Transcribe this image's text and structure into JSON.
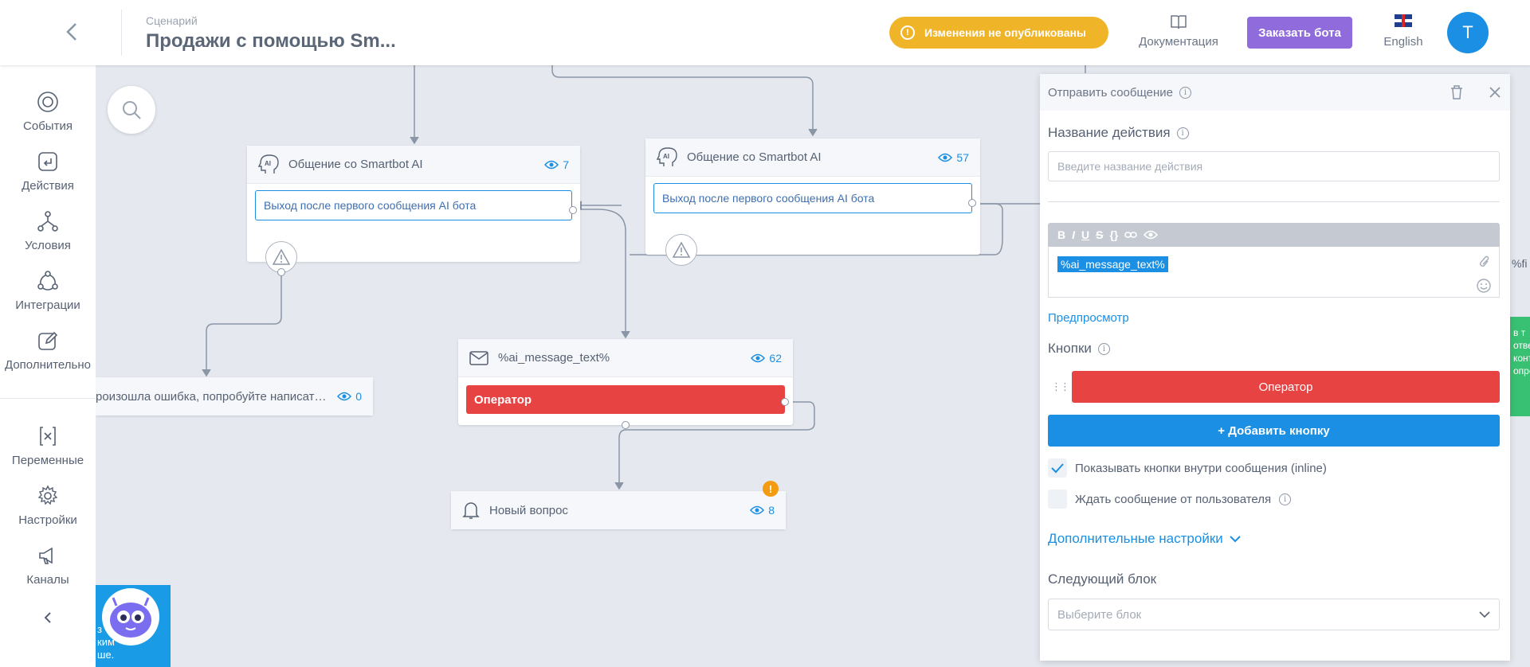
{
  "header": {
    "caption": "Сценарий",
    "title": "Продажи с помощью Sm...",
    "unpublished": "Изменения не опубликованы",
    "docs": "Документация",
    "order_bot": "Заказать бота",
    "language": "English",
    "avatar_letter": "T"
  },
  "sidebar": {
    "items": [
      {
        "label": "События",
        "icon": "events-icon"
      },
      {
        "label": "Действия",
        "icon": "actions-icon"
      },
      {
        "label": "Условия",
        "icon": "conditions-icon"
      },
      {
        "label": "Интеграции",
        "icon": "integrations-icon"
      },
      {
        "label": "Дополнительно",
        "icon": "extra-icon"
      },
      {
        "label": "Переменные",
        "icon": "variables-icon"
      },
      {
        "label": "Настройки",
        "icon": "gear-icon"
      },
      {
        "label": "Каналы",
        "icon": "megaphone-icon"
      }
    ]
  },
  "canvas": {
    "block1": {
      "title": "Общение со Smartbot AI",
      "views": "7",
      "button": "Выход после первого сообщения AI бота"
    },
    "block2": {
      "title": "Общение со Smartbot AI",
      "views": "57",
      "button": "Выход после первого сообщения AI бота"
    },
    "block3": {
      "title": "%ai_message_text%",
      "views": "62",
      "button": "Оператор"
    },
    "block4": {
      "title": "Новый вопрос",
      "views": "8"
    },
    "block5": {
      "title": "роизошла ошибка, попробуйте написать...",
      "views": "0"
    },
    "stub_var": "%fi",
    "stub_green": "в т ответ контр опре",
    "robot_text": [
      "з",
      "ким",
      "ше."
    ]
  },
  "panel": {
    "title": "Отправить сообщение",
    "action_name_label": "Название действия",
    "action_name_placeholder": "Введите название действия",
    "editor_var": "%ai_message_text%",
    "toolbar": [
      "B",
      "I",
      "U",
      "S",
      "{}"
    ],
    "preview": "Предпросмотр",
    "buttons_label": "Кнопки",
    "operator_button": "Оператор",
    "add_button": "+ Добавить кнопку",
    "inline_check": "Показывать кнопки внутри сообщения (inline)",
    "wait_check": "Ждать сообщение от пользователя",
    "advanced": "Дополнительные настройки",
    "next_block_label": "Следующий блок",
    "next_block_placeholder": "Выберите блок"
  },
  "colors": {
    "accent": "#1a8fe3",
    "danger": "#e84343",
    "warning": "#f0b429",
    "purple": "#8f6bdc"
  }
}
